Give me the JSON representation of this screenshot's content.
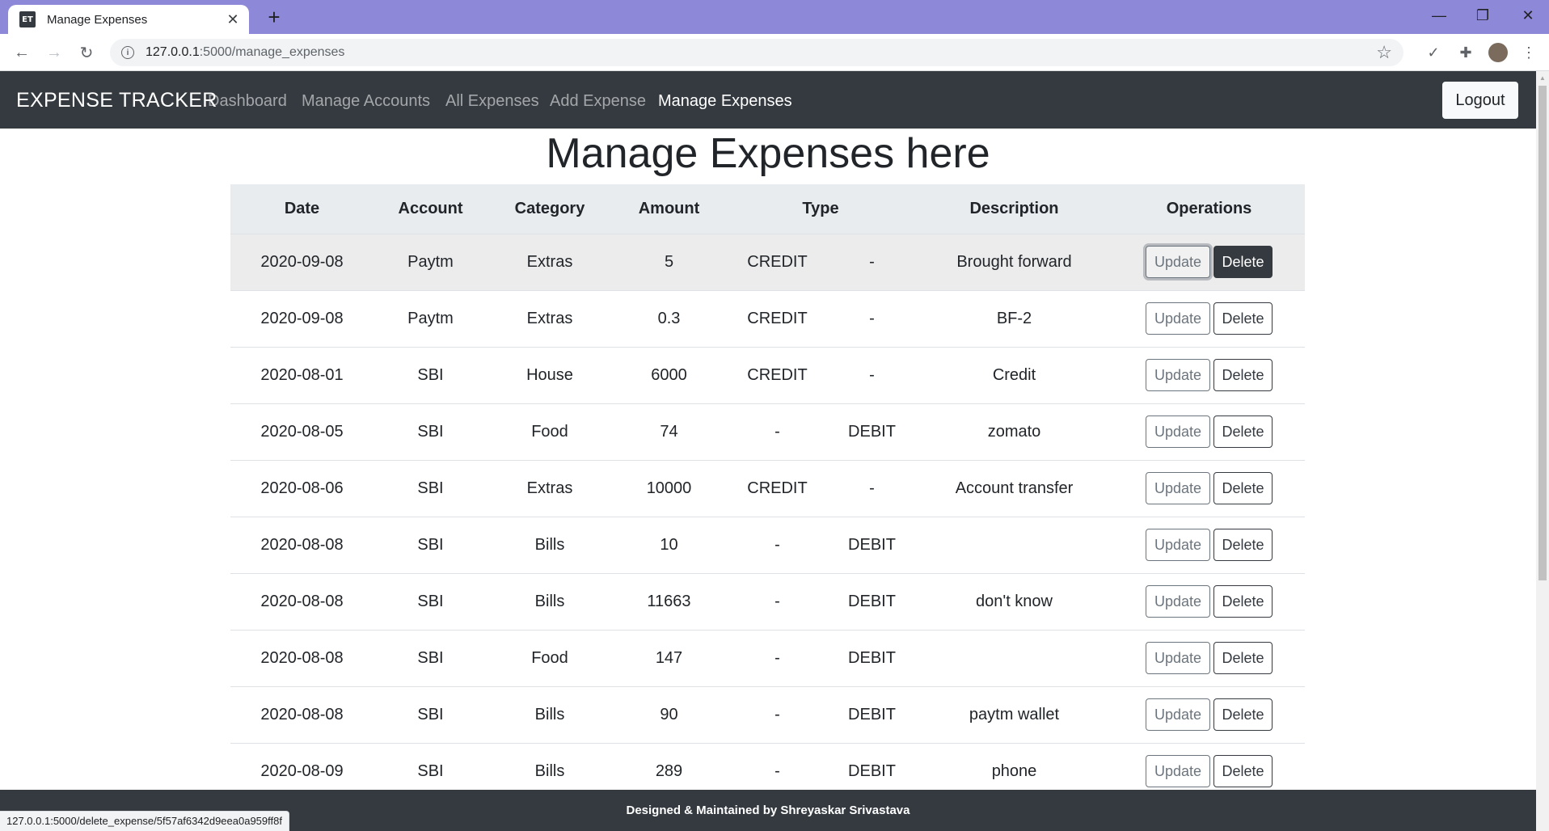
{
  "browser": {
    "tab_title": "Manage Expenses",
    "favicon_text": "ET",
    "url_host": "127.0.0.1",
    "url_path": ":5000/manage_expenses",
    "status_url": "127.0.0.1:5000/delete_expense/5f57af6342d9eea0a959ff8f"
  },
  "navbar": {
    "brand": "EXPENSE TRACKER",
    "links": [
      "Dashboard",
      "Manage Accounts",
      "All Expenses",
      "Add Expense",
      "Manage Expenses"
    ],
    "active_link": "Manage Expenses",
    "logout_label": "Logout"
  },
  "page": {
    "title": "Manage Expenses here"
  },
  "table": {
    "headers": [
      "Date",
      "Account",
      "Category",
      "Amount",
      "Type",
      "Description",
      "Operations"
    ],
    "update_label": "Update",
    "delete_label": "Delete",
    "rows": [
      {
        "date": "2020-09-08",
        "account": "Paytm",
        "category": "Extras",
        "amount": "5",
        "credit": "CREDIT",
        "debit": "-",
        "description": "Brought forward"
      },
      {
        "date": "2020-09-08",
        "account": "Paytm",
        "category": "Extras",
        "amount": "0.3",
        "credit": "CREDIT",
        "debit": "-",
        "description": "BF-2"
      },
      {
        "date": "2020-08-01",
        "account": "SBI",
        "category": "House",
        "amount": "6000",
        "credit": "CREDIT",
        "debit": "-",
        "description": "Credit"
      },
      {
        "date": "2020-08-05",
        "account": "SBI",
        "category": "Food",
        "amount": "74",
        "credit": "-",
        "debit": "DEBIT",
        "description": "zomato"
      },
      {
        "date": "2020-08-06",
        "account": "SBI",
        "category": "Extras",
        "amount": "10000",
        "credit": "CREDIT",
        "debit": "-",
        "description": "Account transfer"
      },
      {
        "date": "2020-08-08",
        "account": "SBI",
        "category": "Bills",
        "amount": "10",
        "credit": "-",
        "debit": "DEBIT",
        "description": ""
      },
      {
        "date": "2020-08-08",
        "account": "SBI",
        "category": "Bills",
        "amount": "11663",
        "credit": "-",
        "debit": "DEBIT",
        "description": "don't know"
      },
      {
        "date": "2020-08-08",
        "account": "SBI",
        "category": "Food",
        "amount": "147",
        "credit": "-",
        "debit": "DEBIT",
        "description": ""
      },
      {
        "date": "2020-08-08",
        "account": "SBI",
        "category": "Bills",
        "amount": "90",
        "credit": "-",
        "debit": "DEBIT",
        "description": "paytm wallet"
      },
      {
        "date": "2020-08-09",
        "account": "SBI",
        "category": "Bills",
        "amount": "289",
        "credit": "-",
        "debit": "DEBIT",
        "description": "phone"
      }
    ]
  },
  "footer": {
    "text": "Designed & Maintained by Shreyaskar Srivastava"
  }
}
